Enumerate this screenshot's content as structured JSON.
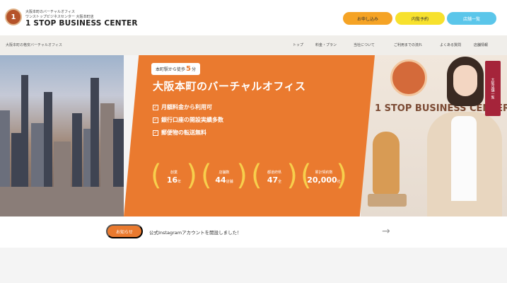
{
  "header": {
    "logo_text": "1",
    "brand_line1": "大阪本町のバーチャルオフィス",
    "brand_line2": "ワンストップビジネスセンター 大阪本町店",
    "brand_name": "1 STOP BUSINESS CENTER",
    "buttons": {
      "apply": "お申し込み",
      "visit": "内覧予約",
      "list": "店舗一覧"
    }
  },
  "nav": {
    "tagline": "大阪本町の格安バーチャルオフィス",
    "items": [
      "トップ",
      "料金・プラン",
      "当社について",
      "ご利用までの流れ",
      "よくある質問",
      "店舗情報"
    ]
  },
  "hero": {
    "badge_prefix": "本町駅から徒歩",
    "badge_number": "5",
    "badge_suffix": "分",
    "title": "大阪本町のバーチャルオフィス",
    "features": [
      "月額料金から利用可",
      "銀行口座の開設実績多数",
      "郵便物の転送無料"
    ],
    "side_tab": "大阪店舗一覧",
    "wall_text": "1 STOP BUSINESS CENTER",
    "stats": [
      {
        "label": "創業",
        "value": "16",
        "unit": "年"
      },
      {
        "label": "店舗数",
        "value": "44",
        "unit": "店舗"
      },
      {
        "label": "都道府県",
        "value": "47",
        "unit": "全"
      },
      {
        "label": "累計契約数",
        "value": "20,000",
        "unit": "社"
      }
    ]
  },
  "news": {
    "button": "お知らせ",
    "text": "公式Instagramアカウントを開設しました！",
    "arrow": "→"
  },
  "colors": {
    "accent": "#ea7a2f",
    "apply_button": "#f5a325",
    "visit_button": "#f7e12d",
    "list_button": "#5bc6ea",
    "side_tab": "#a5243a"
  }
}
